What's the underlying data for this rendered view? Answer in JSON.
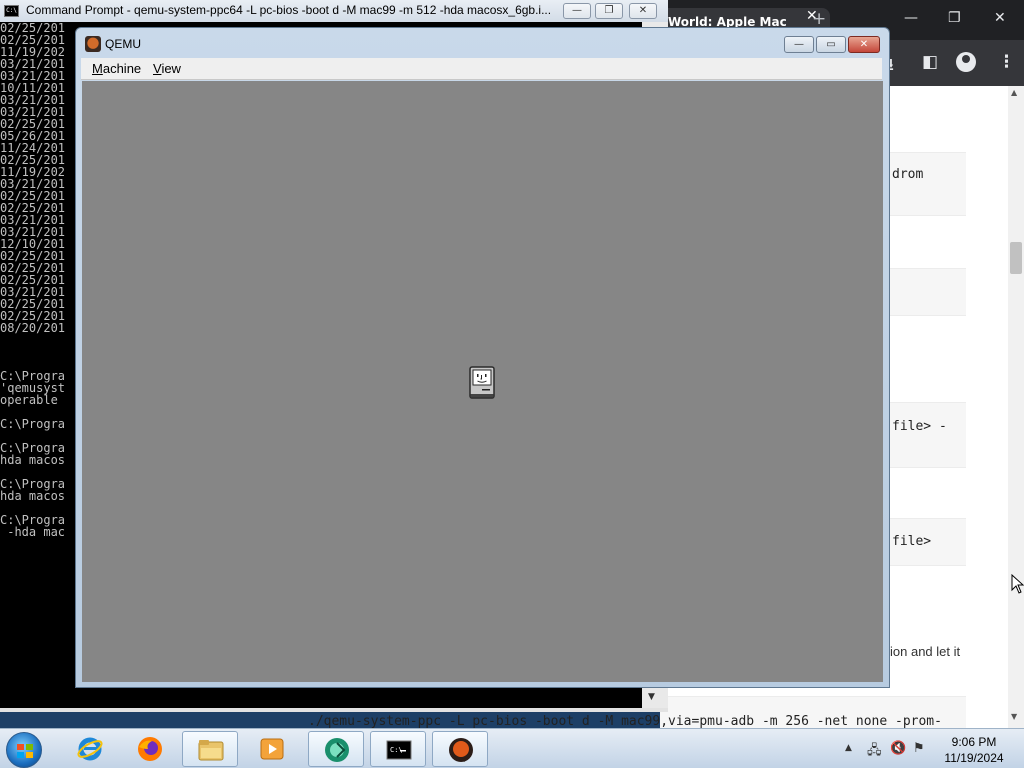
{
  "browser": {
    "tab_title": "World: Apple Mac",
    "tab_close_label": "✕",
    "new_tab_label": "+",
    "window_buttons": [
      "—",
      "❐",
      "✕"
    ],
    "toolbar_icons": [
      "download-icon",
      "sidepanel-icon",
      "profile-icon",
      "menu-icon"
    ],
    "code_snippets": [
      "drom",
      "file> -",
      "file>"
    ],
    "paragraph_text": "ion and let it",
    "bottom_command": "./qemu-system-ppc -L pc-bios -boot d -M mac99,via=pmu-adb -m 256 -net none -prom-"
  },
  "cmd": {
    "title": "Command Prompt - qemu-system-ppc64  -L pc-bios -boot d -M mac99 -m 512 -hda macosx_6gb.i...",
    "icon_text": "C:\\",
    "buttons": [
      "—",
      "❐",
      "✕"
    ],
    "console_text": "02/25/201\n02/25/201\n11/19/202\n03/21/201\n03/21/201\n10/11/201\n03/21/201\n03/21/201\n02/25/201\n05/26/201\n11/24/201\n02/25/201\n11/19/202\n03/21/201\n02/25/201\n02/25/201\n03/21/201\n03/21/201\n12/10/201\n02/25/201\n02/25/201\n02/25/201\n03/21/201\n02/25/201\n02/25/201\n08/20/201\n\n\n\nC:\\Progra\n'qemusyst\noperable\n\nC:\\Progra\n\nC:\\Progra\nhda macos\n\nC:\\Progra\nhda macos\n\nC:\\Progra\n -hda mac"
  },
  "qemu": {
    "title": "QEMU",
    "buttons": [
      "—",
      "▭",
      "✕"
    ],
    "menu": [
      {
        "underline": "M",
        "rest": "achine"
      },
      {
        "underline": "V",
        "rest": "iew"
      }
    ],
    "screen_color": "#868686",
    "boot_icon": "happy-mac-icon"
  },
  "taskbar": {
    "apps": [
      "start-button",
      "internet-explorer-icon",
      "firefox-icon",
      "file-explorer-icon",
      "media-player-icon",
      "qemu-launcher-icon",
      "command-prompt-icon",
      "qemu-icon"
    ],
    "tray_arrow": "▲",
    "tray_icons": [
      "network-icon",
      "volume-muted-icon",
      "flag-icon"
    ],
    "time": "9:06 PM",
    "date": "11/19/2024"
  }
}
